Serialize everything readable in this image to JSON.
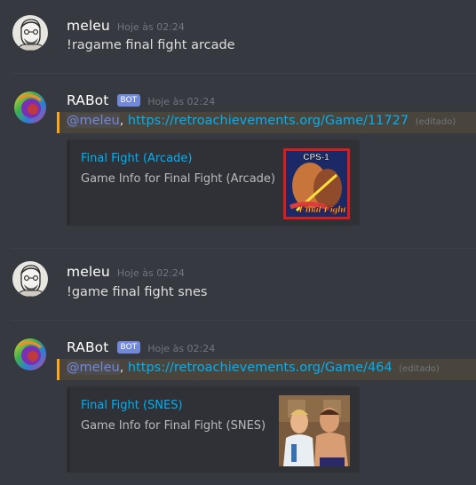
{
  "messages": [
    {
      "author": "meleu",
      "timestamp": "Hoje às 02:24",
      "text": "!ragame final fight arcade"
    },
    {
      "author": "RABot",
      "bot_tag": "BOT",
      "timestamp": "Hoje às 02:24",
      "mention": "@meleu",
      "separator": ",",
      "link": "https://retroachievements.org/Game/11727",
      "edited": "(editado)",
      "embed": {
        "title": "Final Fight (Arcade)",
        "description": "Game Info for Final Fight (Arcade)",
        "thumbnail_label": "CPS-1",
        "thumbnail_logo": "Final Fight"
      }
    },
    {
      "author": "meleu",
      "timestamp": "Hoje às 02:24",
      "text": "!game final fight snes"
    },
    {
      "author": "RABot",
      "bot_tag": "BOT",
      "timestamp": "Hoje às 02:24",
      "mention": "@meleu",
      "separator": ",",
      "link": "https://retroachievements.org/Game/464",
      "edited": "(editado)",
      "embed": {
        "title": "Final Fight (SNES)",
        "description": "Game Info for Final Fight (SNES)",
        "thumbnail_label": "",
        "thumbnail_logo": ""
      }
    }
  ],
  "colors": {
    "background": "#36393f",
    "embed_background": "#2f3136",
    "link": "#00b0f4",
    "mention": "#7289da",
    "bot_tag": "#7289da",
    "mention_highlight_border": "#faa61a"
  },
  "icons": {
    "user_avatar": "sketch-face-avatar",
    "bot_avatar": "rainbow-swirl-avatar"
  }
}
